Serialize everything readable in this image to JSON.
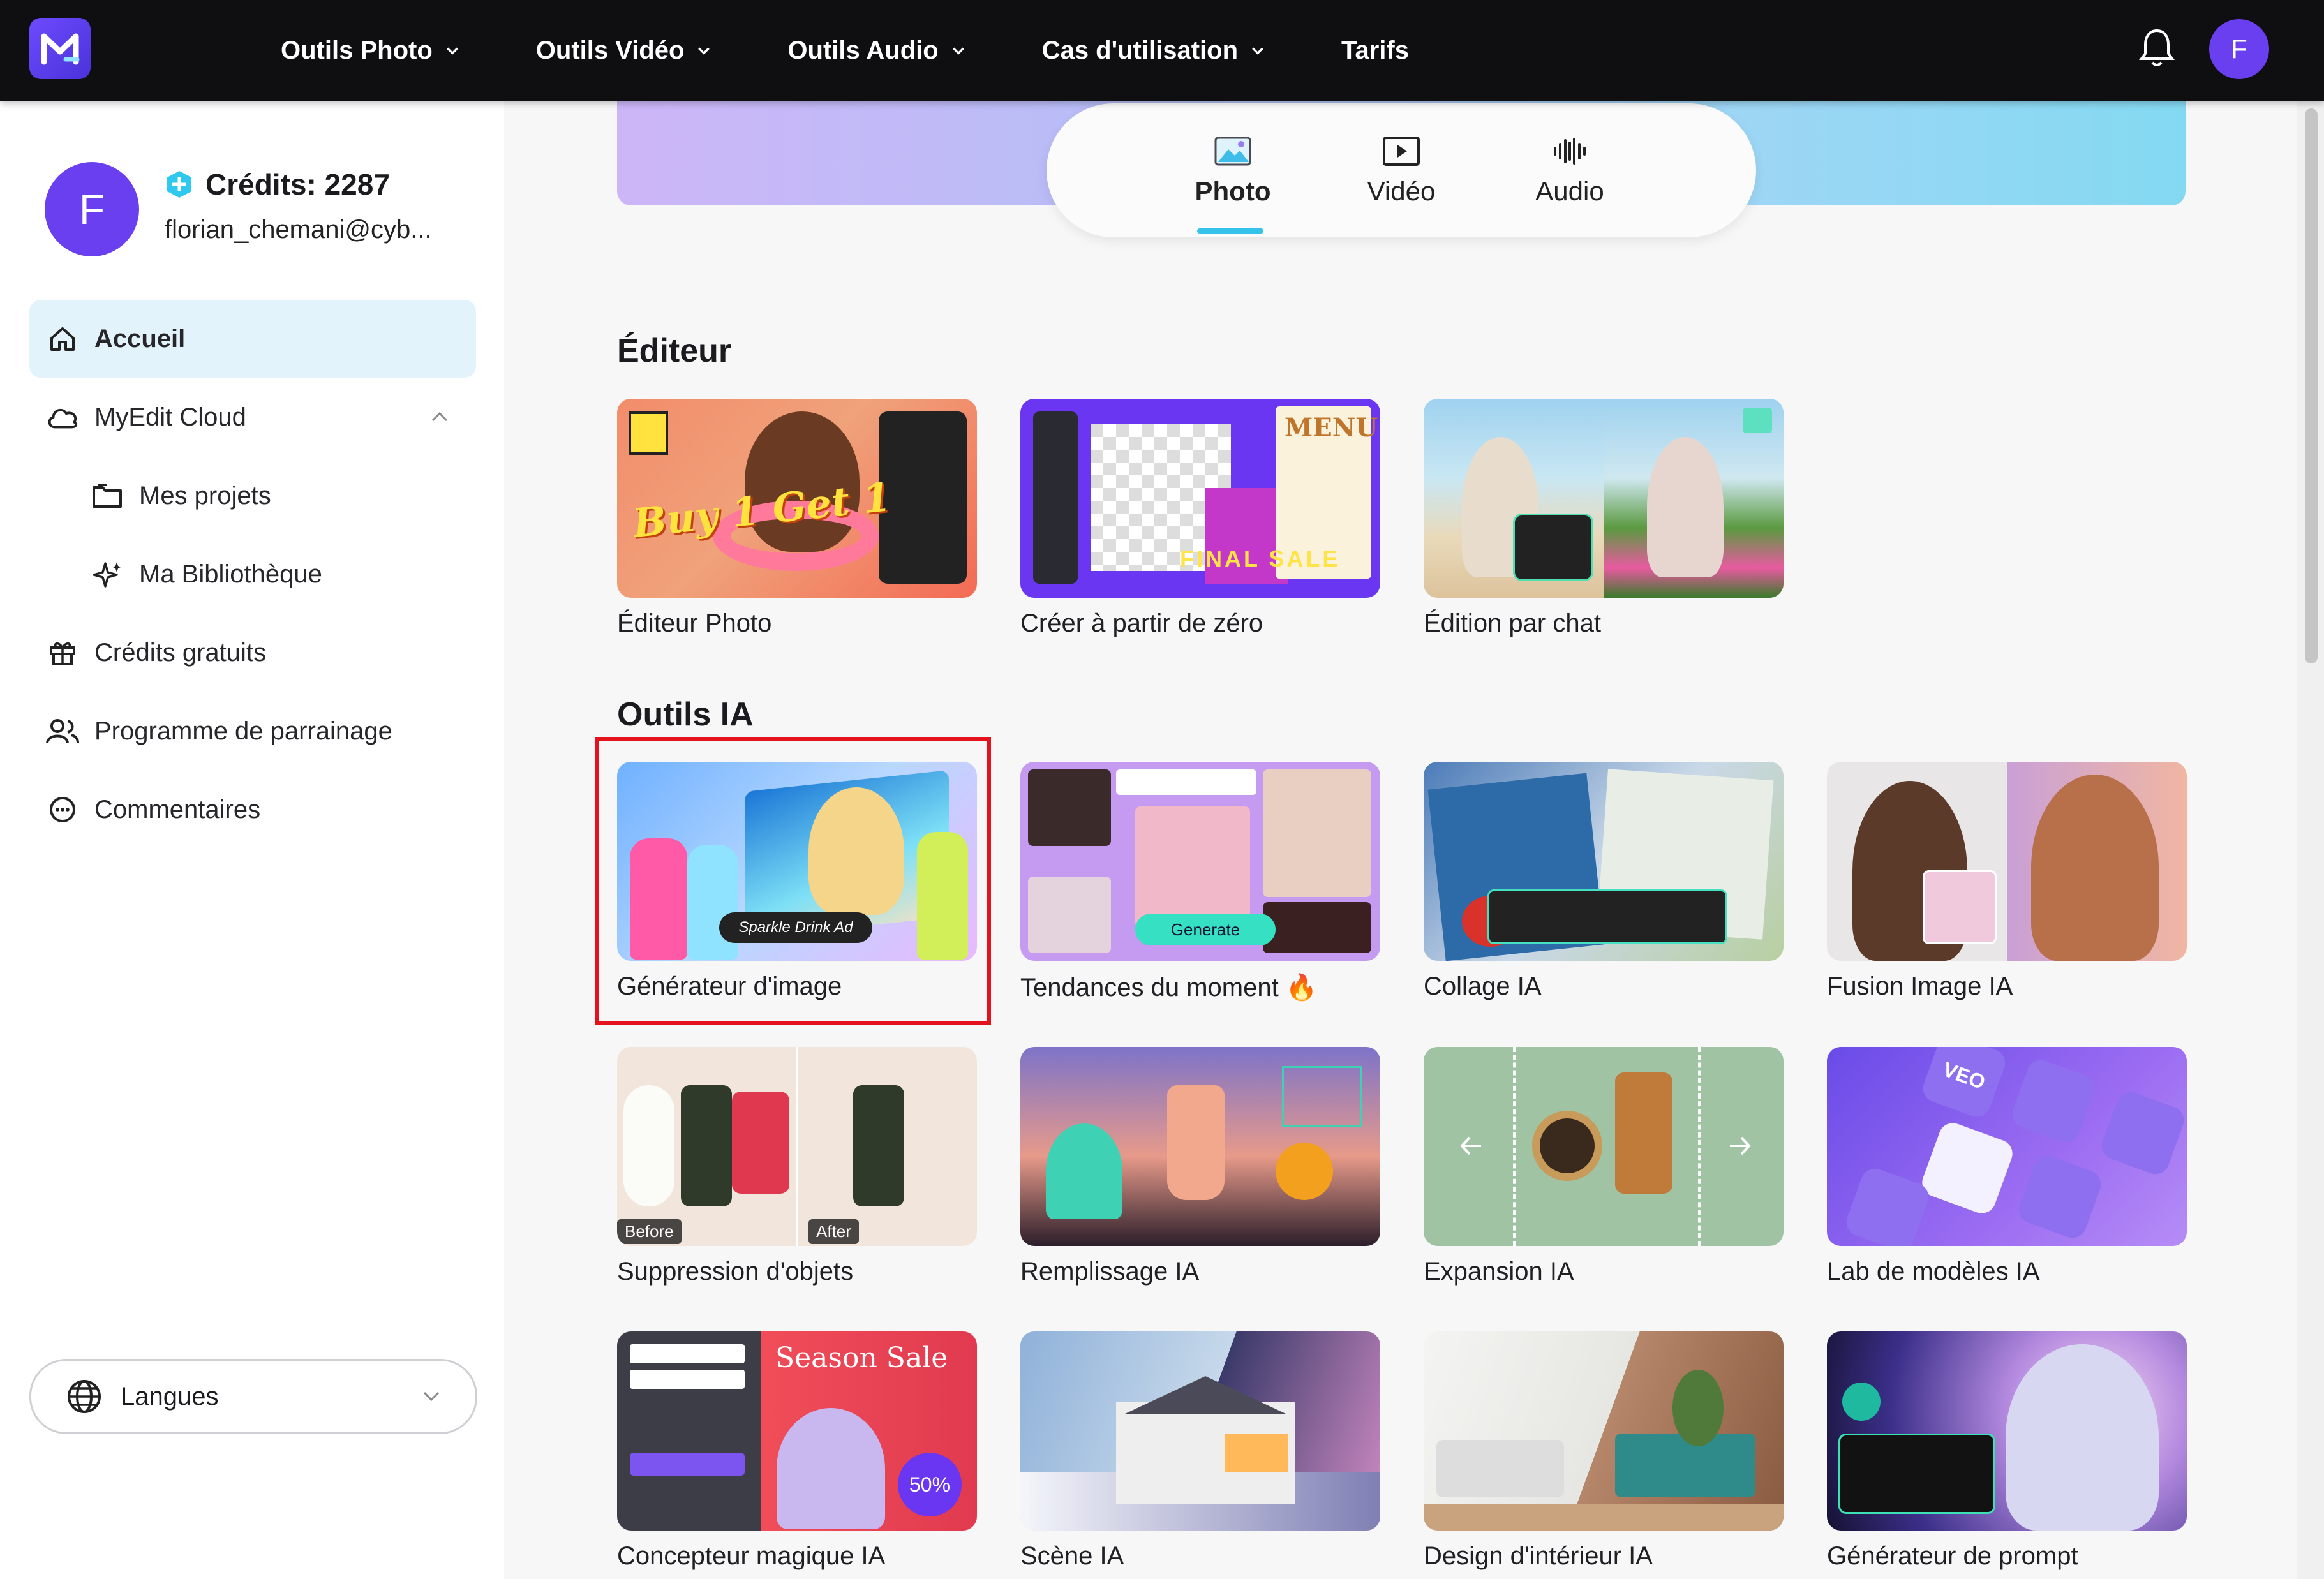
{
  "topbar": {
    "nav": [
      "Outils Photo",
      "Outils Vidéo",
      "Outils Audio",
      "Cas d'utilisation",
      "Tarifs"
    ],
    "nav_has_dropdown": [
      true,
      true,
      true,
      true,
      false
    ],
    "avatar_letter": "F"
  },
  "profile": {
    "avatar_letter": "F",
    "credits": "Crédits: 2287",
    "email": "florian_chemani@cyb..."
  },
  "sidebar": {
    "items": [
      {
        "label": "Accueil",
        "icon": "home-icon",
        "active": true
      },
      {
        "label": "MyEdit Cloud",
        "icon": "cloud-icon"
      },
      {
        "label": "Mes projets",
        "icon": "folder-icon"
      },
      {
        "label": "Ma Bibliothèque",
        "icon": "sparkle-icon"
      },
      {
        "label": "Crédits gratuits",
        "icon": "gift-icon"
      },
      {
        "label": "Programme de parrainage",
        "icon": "users-icon"
      },
      {
        "label": "Commentaires",
        "icon": "chat-icon"
      }
    ],
    "language_label": "Langues"
  },
  "media_tabs": [
    {
      "label": "Photo",
      "active": true
    },
    {
      "label": "Vidéo"
    },
    {
      "label": "Audio"
    }
  ],
  "sections": {
    "editor_title": "Éditeur",
    "ai_title": "Outils IA"
  },
  "editor_cards": [
    "Éditeur Photo",
    "Créer à partir de zéro",
    "Édition par chat"
  ],
  "ai_cards": [
    "Générateur d'image",
    "Tendances du moment 🔥",
    "Collage IA",
    "Fusion Image IA",
    "Suppression d'objets",
    "Remplissage IA",
    "Expansion IA",
    "Lab de modèles IA",
    "Concepteur magique IA",
    "Scène IA",
    "Design d'intérieur IA",
    "Générateur de prompt"
  ],
  "thumb_text": {
    "buy1get1": "Buy 1 Get 1",
    "menu": "MENU",
    "final_sale": "FINAL SALE",
    "sparkle_ad": "Sparkle Drink Ad",
    "generate": "Generate",
    "before": "Before",
    "after": "After",
    "season_sale": "Season Sale",
    "fifty_off": "50%",
    "veo": "VEO"
  },
  "colors": {
    "accent": "#6a3ff0",
    "active_tab_underline": "#35c3ec",
    "highlight_box": "#e3121c"
  }
}
